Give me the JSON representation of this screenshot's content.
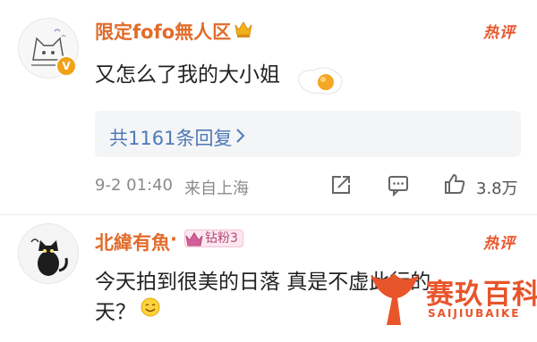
{
  "comments": [
    {
      "username": "限定fofo無人区",
      "hot_label": "热评",
      "text": "又怎么了我的大小姐",
      "reply_count_label": "共1161条回复",
      "date_time": "9-2 01:40",
      "location": "来自上海",
      "like_count": "3.8万",
      "verified_badge": "V"
    },
    {
      "username": "北緯有魚",
      "separator": "·",
      "fan_badge": "钻粉3",
      "hot_label": "热评",
      "text_line1": "今天拍到很美的日落 真是不虚此行的",
      "text_line2": "天？"
    }
  ],
  "watermark": {
    "title": "赛玖百科",
    "subtitle": "SAIJIUBAIKE"
  },
  "colors": {
    "username": "#e16b2b",
    "hot": "#e8552a",
    "reply_link": "#4e79b8",
    "watermark": "#e8552a"
  }
}
